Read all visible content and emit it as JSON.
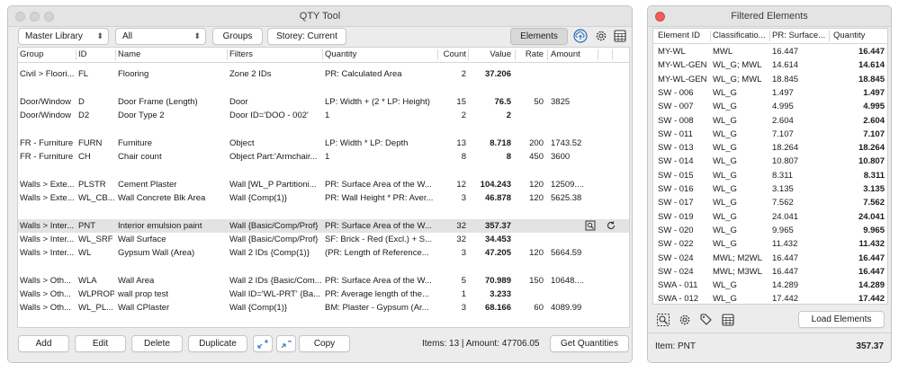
{
  "qty_window": {
    "title": "QTY Tool",
    "library_select": "Master Library",
    "filter_select": "All",
    "groups_button": "Groups",
    "storey_button": "Storey: Current",
    "elements_button": "Elements",
    "columns": [
      "Group",
      "ID",
      "Name",
      "Filters",
      "Quantity",
      "Count",
      "Value",
      "Rate",
      "Amount"
    ],
    "rows": [
      {
        "group": "Civil > Floori...",
        "id": "FL",
        "name": "Flooring",
        "filters": "Zone 2 IDs",
        "quantity": "PR: Calculated Area",
        "count": "2",
        "value": "37.206",
        "rate": "",
        "amount": ""
      },
      {
        "group": "Door/Window",
        "id": "D",
        "name": "Door Frame (Length)",
        "filters": "Door",
        "quantity": "LP: Width + (2 * LP: Height)",
        "count": "15",
        "value": "76.5",
        "rate": "50",
        "amount": "3825"
      },
      {
        "group": "Door/Window",
        "id": "D2",
        "name": "Door Type 2",
        "filters": "Door ID='DOO - 002'",
        "quantity": "1",
        "count": "2",
        "value": "2",
        "rate": "",
        "amount": ""
      },
      {
        "group": "FR - Furniture",
        "id": "FURN",
        "name": "Furniture",
        "filters": "Object",
        "quantity": "LP: Width * LP: Depth",
        "count": "13",
        "value": "8.718",
        "rate": "200",
        "amount": "1743.52"
      },
      {
        "group": "FR - Furniture",
        "id": "CH",
        "name": "Chair count",
        "filters": "Object Part:'Armchair...",
        "quantity": "1",
        "count": "8",
        "value": "8",
        "rate": "450",
        "amount": "3600"
      },
      {
        "group": "Walls > Exte...",
        "id": "PLSTR",
        "name": "Cement Plaster",
        "filters": "Wall [WL_P Partitioni...",
        "quantity": "PR: Surface Area of the W...",
        "count": "12",
        "value": "104.243",
        "rate": "120",
        "amount": "12509...."
      },
      {
        "group": "Walls > Exte...",
        "id": "WL_CB...",
        "name": "Wall Concrete Blk Area",
        "filters": "Wall {Comp(1)}",
        "quantity": "PR: Wall Height * PR: Aver...",
        "count": "3",
        "value": "46.878",
        "rate": "120",
        "amount": "5625.38"
      },
      {
        "group": "Walls > Inter...",
        "id": "PNT",
        "name": "Interior emulsion paint",
        "filters": "Wall {Basic/Comp/Prof}",
        "quantity": "PR: Surface Area of the W...",
        "count": "32",
        "value": "357.37",
        "rate": "",
        "amount": ""
      },
      {
        "group": "Walls > Inter...",
        "id": "WL_SRF",
        "name": "Wall Surface",
        "filters": "Wall {Basic/Comp/Prof}",
        "quantity": "SF: Brick - Red (Excl.) + S...",
        "count": "32",
        "value": "34.453",
        "rate": "",
        "amount": ""
      },
      {
        "group": "Walls > Inter...",
        "id": "WL",
        "name": "Gypsum Wall (Area)",
        "filters": "Wall 2 IDs {Comp(1)}",
        "quantity": "(PR: Length of Reference...",
        "count": "3",
        "value": "47.205",
        "rate": "120",
        "amount": "5664.59"
      },
      {
        "group": "Walls > Oth...",
        "id": "WLA",
        "name": "Wall Area",
        "filters": "Wall 2 IDs {Basic/Com...",
        "quantity": "PR: Surface Area of the W...",
        "count": "5",
        "value": "70.989",
        "rate": "150",
        "amount": "10648...."
      },
      {
        "group": "Walls > Oth...",
        "id": "WLPROP",
        "name": "wall prop test",
        "filters": "Wall ID='WL-PRT' {Ba...",
        "quantity": "PR: Average length of the...",
        "count": "1",
        "value": "3.233",
        "rate": "",
        "amount": ""
      },
      {
        "group": "Walls > Oth...",
        "id": "WL_PL...",
        "name": "Wall CPlaster",
        "filters": "Wall {Comp(1)}",
        "quantity": "BM: Plaster - Gypsum (Ar...",
        "count": "3",
        "value": "68.166",
        "rate": "60",
        "amount": "4089.99"
      }
    ],
    "buttons": {
      "add": "Add",
      "edit": "Edit",
      "delete": "Delete",
      "duplicate": "Duplicate",
      "copy": "Copy",
      "get_quantities": "Get Quantities"
    },
    "status": "Items: 13 | Amount: 47706.05"
  },
  "filtered_window": {
    "title": "Filtered Elements",
    "columns": [
      "Element ID",
      "Classificatio...",
      "PR: Surface...",
      "Quantity"
    ],
    "rows": [
      {
        "id": "MY-WL",
        "cls": "MWL",
        "surf": "16.447",
        "qty": "16.447"
      },
      {
        "id": "MY-WL-GEN",
        "cls": "WL_G; MWL",
        "surf": "14.614",
        "qty": "14.614"
      },
      {
        "id": "MY-WL-GEN",
        "cls": "WL_G; MWL",
        "surf": "18.845",
        "qty": "18.845"
      },
      {
        "id": "SW - 006",
        "cls": "WL_G",
        "surf": "1.497",
        "qty": "1.497"
      },
      {
        "id": "SW - 007",
        "cls": "WL_G",
        "surf": "4.995",
        "qty": "4.995"
      },
      {
        "id": "SW - 008",
        "cls": "WL_G",
        "surf": "2.604",
        "qty": "2.604"
      },
      {
        "id": "SW - 011",
        "cls": "WL_G",
        "surf": "7.107",
        "qty": "7.107"
      },
      {
        "id": "SW - 013",
        "cls": "WL_G",
        "surf": "18.264",
        "qty": "18.264"
      },
      {
        "id": "SW - 014",
        "cls": "WL_G",
        "surf": "10.807",
        "qty": "10.807"
      },
      {
        "id": "SW - 015",
        "cls": "WL_G",
        "surf": "8.311",
        "qty": "8.311"
      },
      {
        "id": "SW - 016",
        "cls": "WL_G",
        "surf": "3.135",
        "qty": "3.135"
      },
      {
        "id": "SW - 017",
        "cls": "WL_G",
        "surf": "7.562",
        "qty": "7.562"
      },
      {
        "id": "SW - 019",
        "cls": "WL_G",
        "surf": "24.041",
        "qty": "24.041"
      },
      {
        "id": "SW - 020",
        "cls": "WL_G",
        "surf": "9.965",
        "qty": "9.965"
      },
      {
        "id": "SW - 022",
        "cls": "WL_G",
        "surf": "11.432",
        "qty": "11.432"
      },
      {
        "id": "SW - 024",
        "cls": "MWL; M2WL",
        "surf": "16.447",
        "qty": "16.447"
      },
      {
        "id": "SW - 024",
        "cls": "MWL; M3WL",
        "surf": "16.447",
        "qty": "16.447"
      },
      {
        "id": "SWA - 011",
        "cls": "WL_G",
        "surf": "14.289",
        "qty": "14.289"
      },
      {
        "id": "SWA - 012",
        "cls": "WL_G",
        "surf": "17.442",
        "qty": "17.442"
      }
    ],
    "load_button": "Load Elements",
    "status_label": "Item: PNT",
    "status_value": "357.37"
  }
}
